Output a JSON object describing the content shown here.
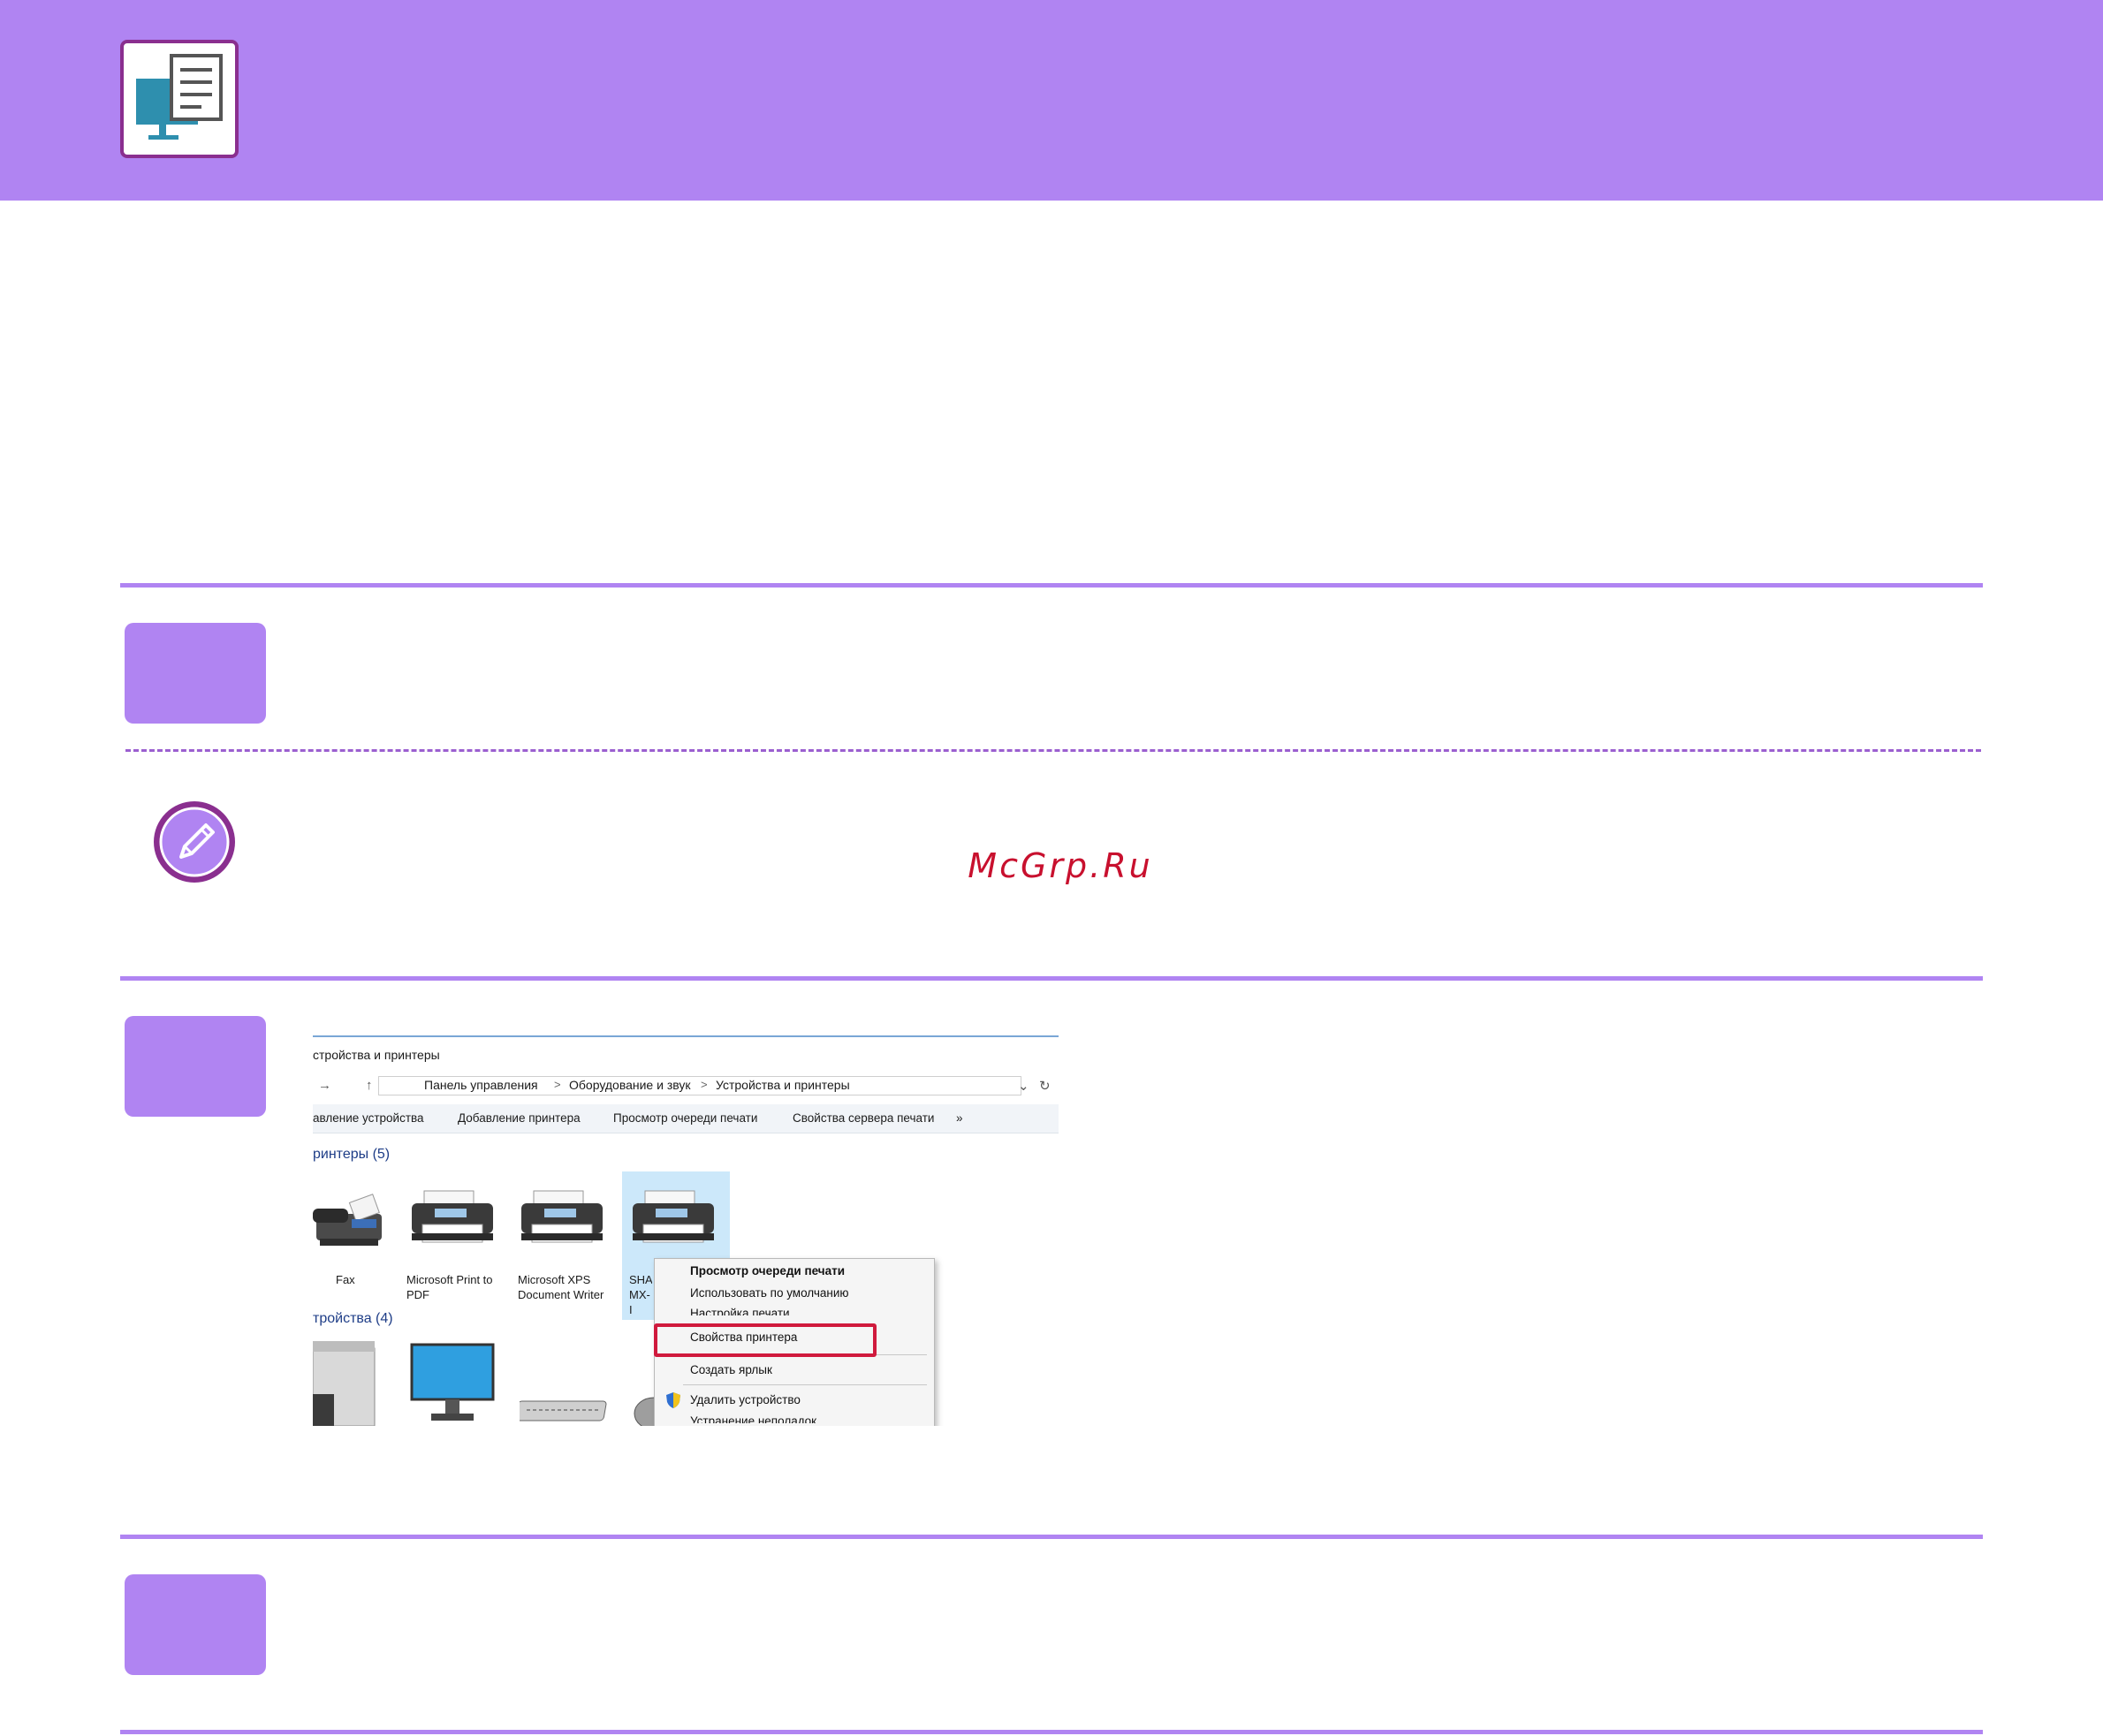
{
  "header": {
    "icon": "computer-document-icon",
    "accent_color": "#b084f2",
    "icon_border_color": "#8a2f8f"
  },
  "steps": [
    {
      "number": ""
    },
    {
      "number": ""
    },
    {
      "number": ""
    }
  ],
  "note": {
    "icon": "pencil-note-icon"
  },
  "watermark": "McGrp.Ru",
  "screenshot": {
    "window_title": "стройства и принтеры",
    "breadcrumb": [
      "Панель управления",
      "Оборудование и звук",
      "Устройства и принтеры"
    ],
    "breadcrumb_sep": ">",
    "toolbar": [
      "авление устройства",
      "Добавление принтера",
      "Просмотр очереди печати",
      "Свойства сервера печати",
      "»"
    ],
    "printers_header": "ринтеры (5)",
    "printers": [
      {
        "label": "Fax"
      },
      {
        "label": "Microsoft Print to PDF"
      },
      {
        "label": "Microsoft XPS Document Writer"
      },
      {
        "label": "SHAI MX-I"
      }
    ],
    "devices_header": "тройства (4)",
    "context_menu": {
      "items": [
        "Просмотр очереди печати",
        "Использовать по умолчанию",
        "Настройка печати",
        "Свойства принтера",
        "Создать ярлык",
        "Удалить устройство",
        "Устранение неполадок"
      ],
      "highlighted": "Свойства принтера",
      "highlight_color": "#d01a3d"
    }
  }
}
